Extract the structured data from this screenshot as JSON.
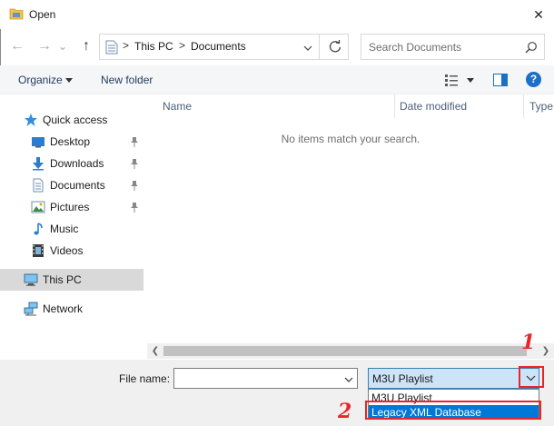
{
  "window": {
    "title": "Open",
    "close_glyph": "✕"
  },
  "navigation": {
    "back_glyph": "←",
    "forward_glyph": "→",
    "recent_glyph": "⌄",
    "up_glyph": "↑",
    "breadcrumb": [
      "This PC",
      "Documents"
    ],
    "separator": ">",
    "search_placeholder": "Search Documents"
  },
  "toolbar": {
    "organize_label": "Organize",
    "new_folder_label": "New folder"
  },
  "sidebar": {
    "items": [
      {
        "label": "Quick access",
        "icon": "star-icon",
        "pinned": false
      },
      {
        "label": "Desktop",
        "icon": "desktop-icon",
        "pinned": true
      },
      {
        "label": "Downloads",
        "icon": "downloads-icon",
        "pinned": true
      },
      {
        "label": "Documents",
        "icon": "documents-icon",
        "pinned": true
      },
      {
        "label": "Pictures",
        "icon": "pictures-icon",
        "pinned": true
      },
      {
        "label": "Music",
        "icon": "music-icon",
        "pinned": false
      },
      {
        "label": "Videos",
        "icon": "videos-icon",
        "pinned": false
      },
      {
        "label": "This PC",
        "icon": "computer-icon",
        "pinned": false,
        "selected": true
      },
      {
        "label": "Network",
        "icon": "network-icon",
        "pinned": false
      }
    ]
  },
  "file_list": {
    "columns": [
      "Name",
      "Date modified",
      "Type"
    ],
    "empty_message": "No items match your search."
  },
  "footer": {
    "file_name_label": "File name:",
    "file_name_value": "",
    "file_type_selected": "M3U Playlist",
    "file_type_options": [
      "M3U Playlist",
      "Legacy XML Database"
    ],
    "highlighted_option": "Legacy XML Database"
  },
  "annotations": {
    "step1": "1",
    "step2": "2"
  },
  "colors": {
    "accent": "#0078d7",
    "annotation": "#e8262a",
    "selected_bg": "#cde3f7"
  }
}
